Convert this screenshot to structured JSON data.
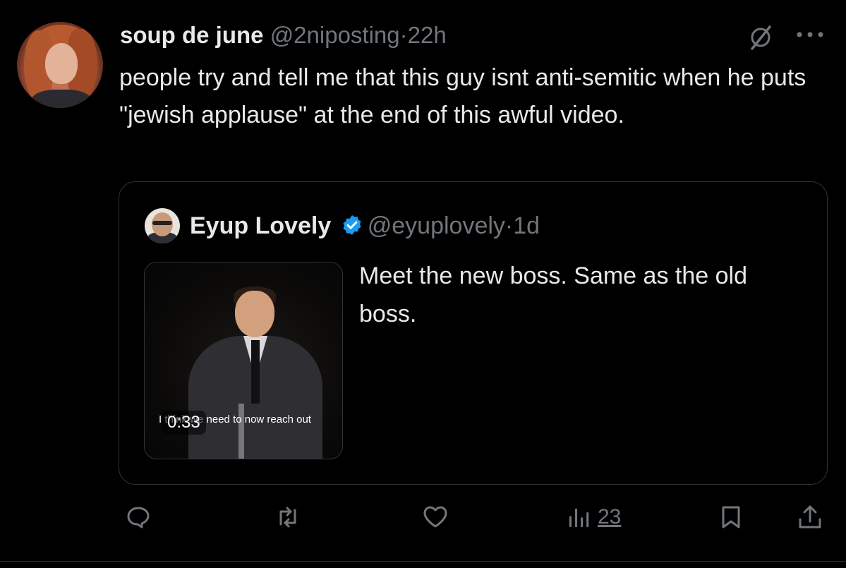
{
  "tweet": {
    "author_name": "soup de june",
    "handle": "@2niposting",
    "dot": "·",
    "time": "22h",
    "text": "people try and tell me that this guy isnt anti-semitic when he puts \"jewish applause\" at the end of this awful video.",
    "more_icon": "more-horizontal-icon",
    "grok_icon": "grok-icon"
  },
  "quote": {
    "author_name": "Eyup Lovely",
    "verified_color": "#1d9bf0",
    "handle": "@eyuplovely",
    "dot": "·",
    "time": "1d",
    "text": "Meet the new boss. Same as the old boss.",
    "media": {
      "caption": "I think we need to now reach out",
      "duration": "0:33"
    }
  },
  "actions": {
    "reply_icon": "reply-icon",
    "retweet_icon": "retweet-icon",
    "like_icon": "heart-icon",
    "views_icon": "analytics-icon",
    "views_count": "23",
    "bookmark_icon": "bookmark-icon",
    "share_icon": "share-icon"
  },
  "colors": {
    "background": "#000000",
    "text": "#e7e9ea",
    "muted": "#71767b",
    "border": "#2f3336",
    "accent": "#1d9bf0"
  }
}
